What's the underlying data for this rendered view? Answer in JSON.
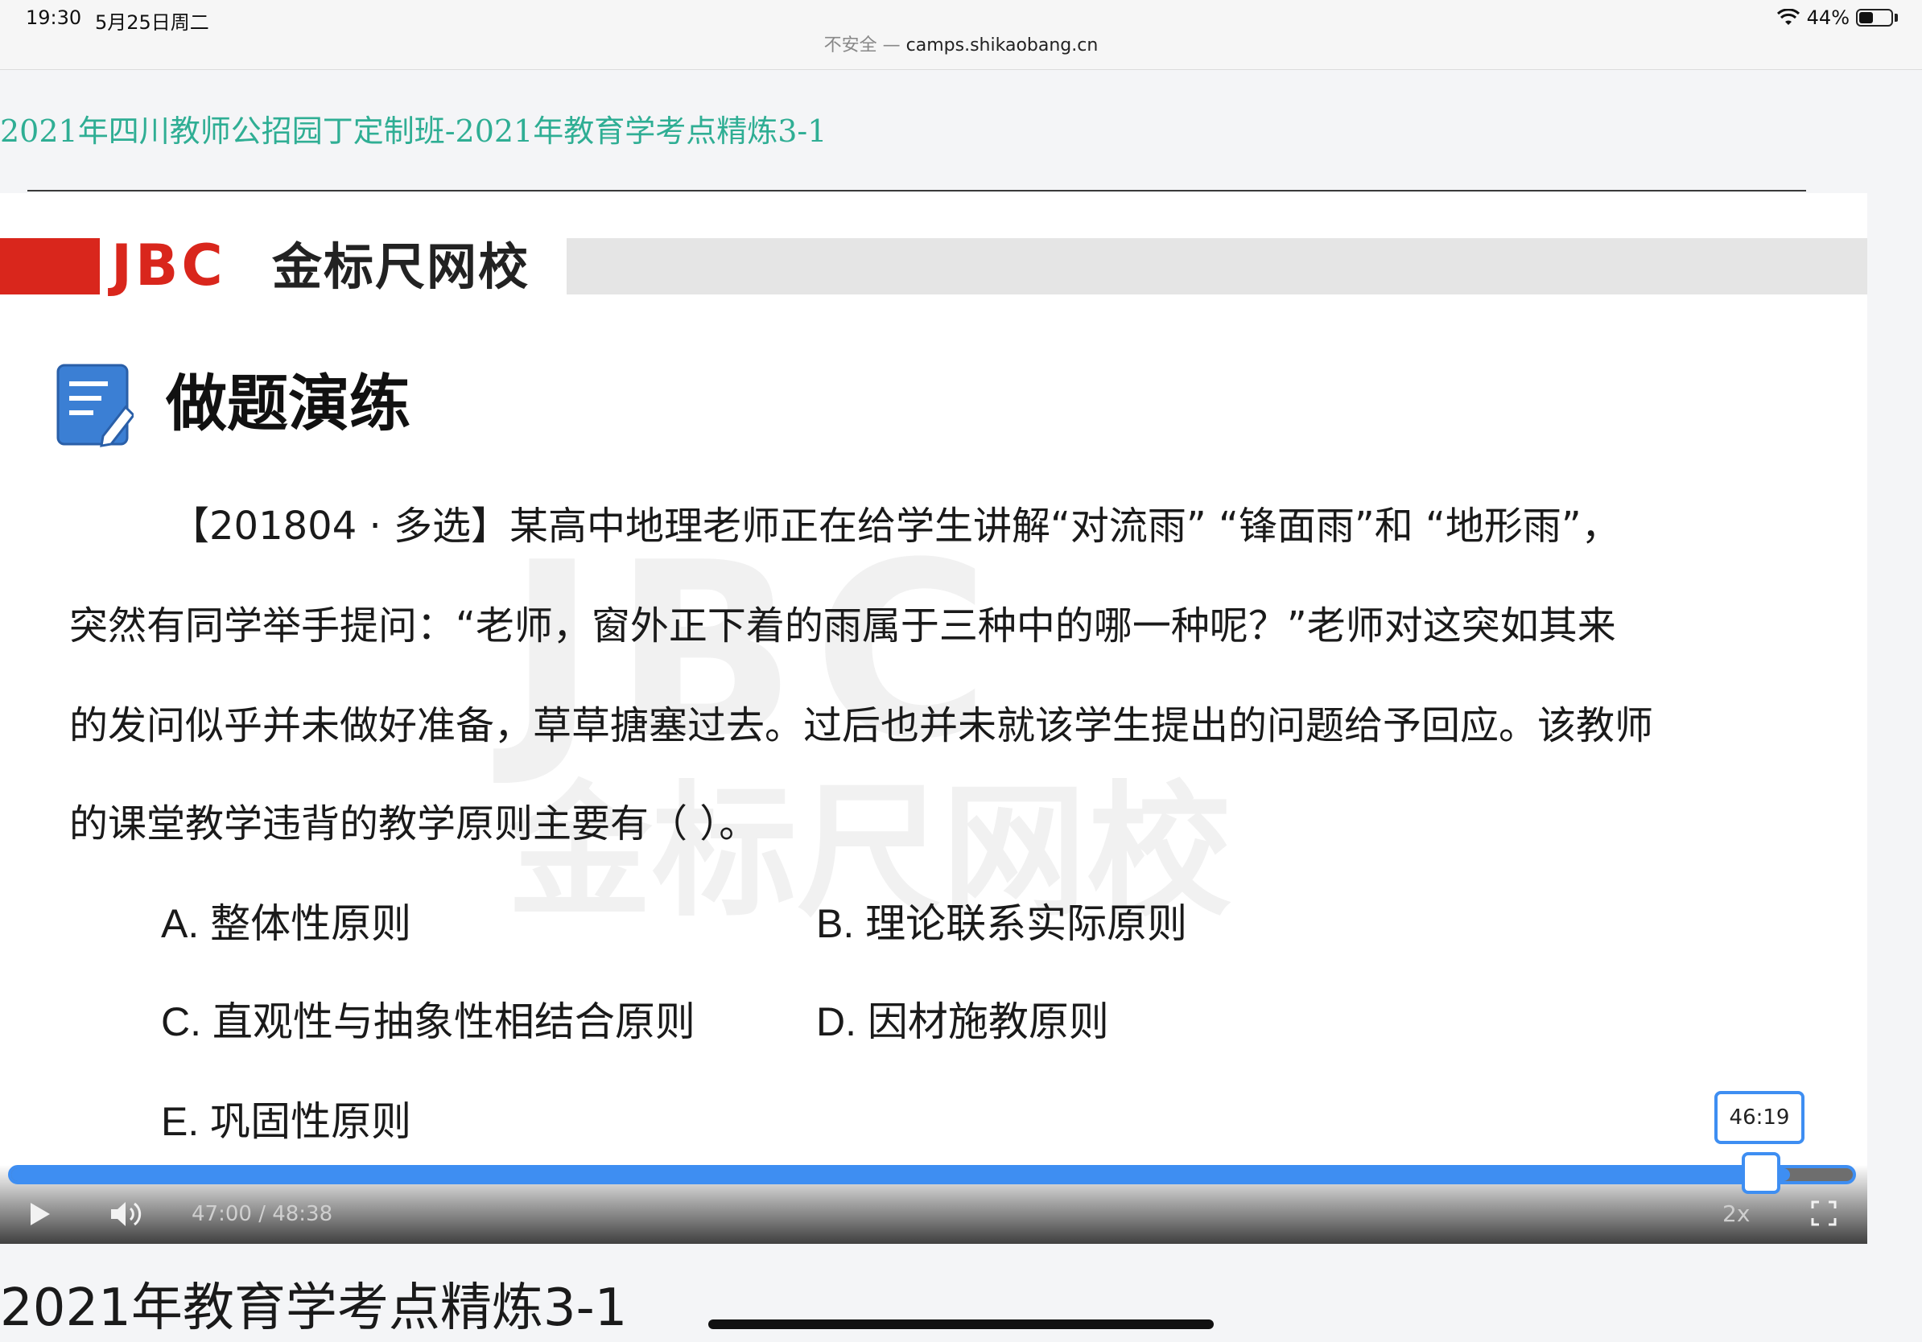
{
  "status_bar": {
    "time": "19:30",
    "date": "5月25日周二",
    "insecure_label": "不安全 —",
    "url": "camps.shikaobang.cn",
    "battery": "44%",
    "battery_level": 0.44
  },
  "course": {
    "title": "2021年四川教师公招园丁定制班-2021年教育学考点精炼3-1"
  },
  "slide": {
    "brand_logo": "JBC",
    "brand_name": "金标尺网校",
    "watermark_logo": "JBC",
    "watermark_name": "金标尺网校",
    "section_title": "做题演练",
    "question_lines": [
      "【201804 · 多选】某高中地理老师正在给学生讲解“对流雨” “锋面雨”和 “地形雨”，",
      "突然有同学举手提问：“老师，窗外正下着的雨属于三种中的哪一种呢？”老师对这突如其来",
      "的发问似乎并未做好准备，草草搪塞过去。过后也并未就该学生提出的问题给予回应。该教师",
      "的课堂教学违背的教学原则主要有（    ）。"
    ],
    "options": {
      "a": "A. 整体性原则",
      "b": "B. 理论联系实际原则",
      "c": "C. 直观性与抽象性相结合原则",
      "d": "D. 因材施教原则",
      "e": "E. 巩固性原则"
    }
  },
  "player": {
    "hover_time": "46:19",
    "time_display": "47:00 / 48:38",
    "speed": "2x",
    "progress_fraction": 0.966
  },
  "footer": {
    "lesson_title": "2021年教育学考点精炼3-1"
  },
  "colors": {
    "accent_blue": "#3e8ef2",
    "brand_red": "#d9261c",
    "title_green": "#2fae94"
  },
  "icons": [
    "wifi-icon",
    "battery-icon",
    "edit-note-icon",
    "play-icon",
    "volume-icon",
    "fullscreen-icon"
  ]
}
